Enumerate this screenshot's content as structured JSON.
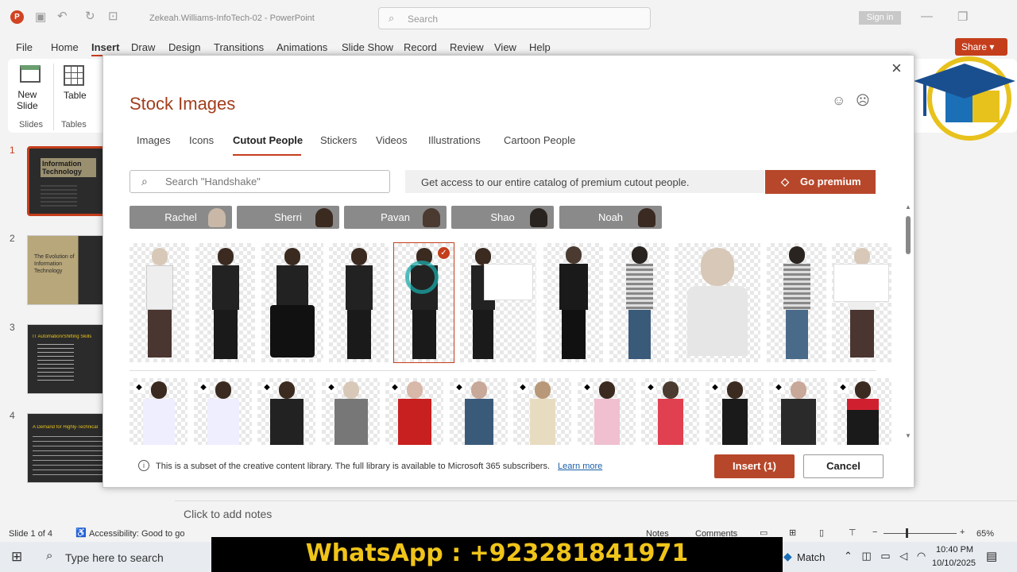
{
  "window": {
    "title": "Zekeah.Williams-InfoTech-02  -  PowerPoint",
    "search_placeholder": "Search",
    "signin": "Sign in"
  },
  "menu": {
    "items": [
      "File",
      "Home",
      "Insert",
      "Draw",
      "Design",
      "Transitions",
      "Animations",
      "Slide Show",
      "Record",
      "Review",
      "View",
      "Help"
    ],
    "share": "Share"
  },
  "ribbon": {
    "new_slide": "New\nSlide",
    "slides_group": "Slides",
    "table": "Table",
    "tables_group": "Tables"
  },
  "slides": {
    "numbers": [
      "1",
      "2",
      "3",
      "4"
    ],
    "s1_title": "Information Technology",
    "s2_title": "The Evolution of Information Technology",
    "s3_title": "IT Automation/Shifting Skills",
    "s4_title": "A Demand for Highly-Technical"
  },
  "notes": {
    "placeholder": "Click to add notes"
  },
  "status": {
    "slide": "Slide 1 of 4",
    "accessibility": "Accessibility: Good to go",
    "notes": "Notes",
    "comments": "Comments",
    "zoom": "65%"
  },
  "taskbar": {
    "search": "Type here to search",
    "match": "Match",
    "time": "10:40 PM",
    "date": "10/10/2025"
  },
  "overlay": {
    "whatsapp": "WhatsApp : +923281841971"
  },
  "dialog": {
    "title": "Stock Images",
    "tabs": [
      "Images",
      "Icons",
      "Cutout People",
      "Stickers",
      "Videos",
      "Illustrations",
      "Cartoon People"
    ],
    "active_tab": "Cutout People",
    "search_placeholder": "Search \"Handshake\"",
    "premium_text": "Get access to our entire catalog of premium cutout people.",
    "go_premium": "Go premium",
    "people": [
      "Rachel",
      "Sherri",
      "Pavan",
      "Shao",
      "Noah"
    ],
    "footer_text": "This is a subset of the creative content library. The full library is available to Microsoft 365 subscribers.",
    "learn_more": "Learn more",
    "insert": "Insert (1)",
    "cancel": "Cancel",
    "close": "×"
  },
  "colors": {
    "accent": "#c43e1c",
    "premium": "#b7472a",
    "chip": "#8a8a8a"
  }
}
